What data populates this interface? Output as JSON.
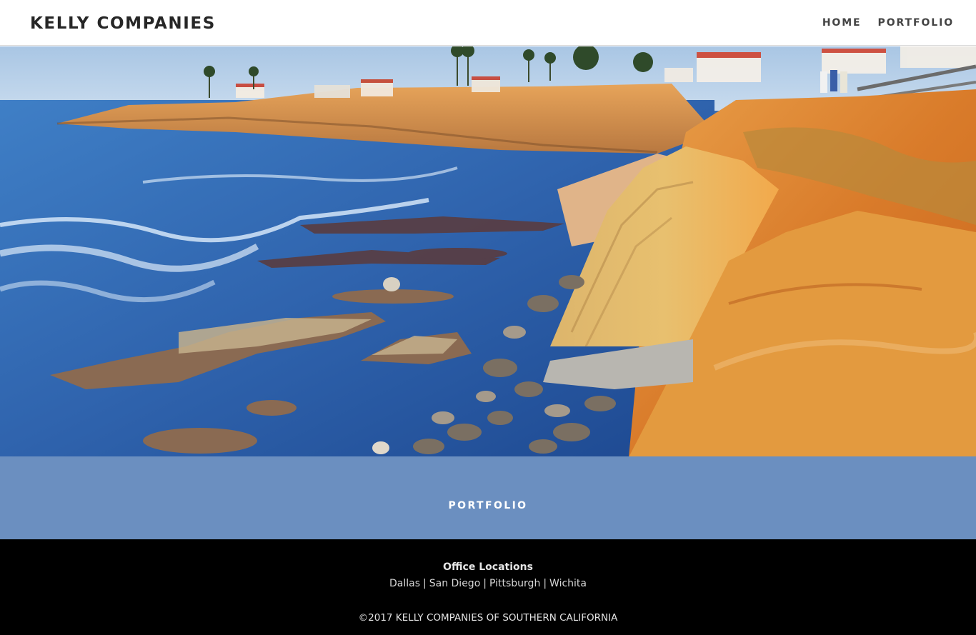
{
  "header": {
    "logo_text": "KELLY COMPANIES",
    "nav": [
      {
        "label": "HOME"
      },
      {
        "label": "PORTFOLIO"
      }
    ]
  },
  "hero": {
    "image_subject": "coastal-cliffs-ocean-photo"
  },
  "band": {
    "title": "PORTFOLIO",
    "color": "#6b8fc0"
  },
  "footer": {
    "office_title": "Office Locations",
    "offices": [
      "Dallas",
      "San Diego",
      "Pittsburgh",
      "Wichita"
    ],
    "separator": "|",
    "copyright": "©2017 KELLY COMPANIES OF SOUTHERN CALIFORNIA"
  }
}
